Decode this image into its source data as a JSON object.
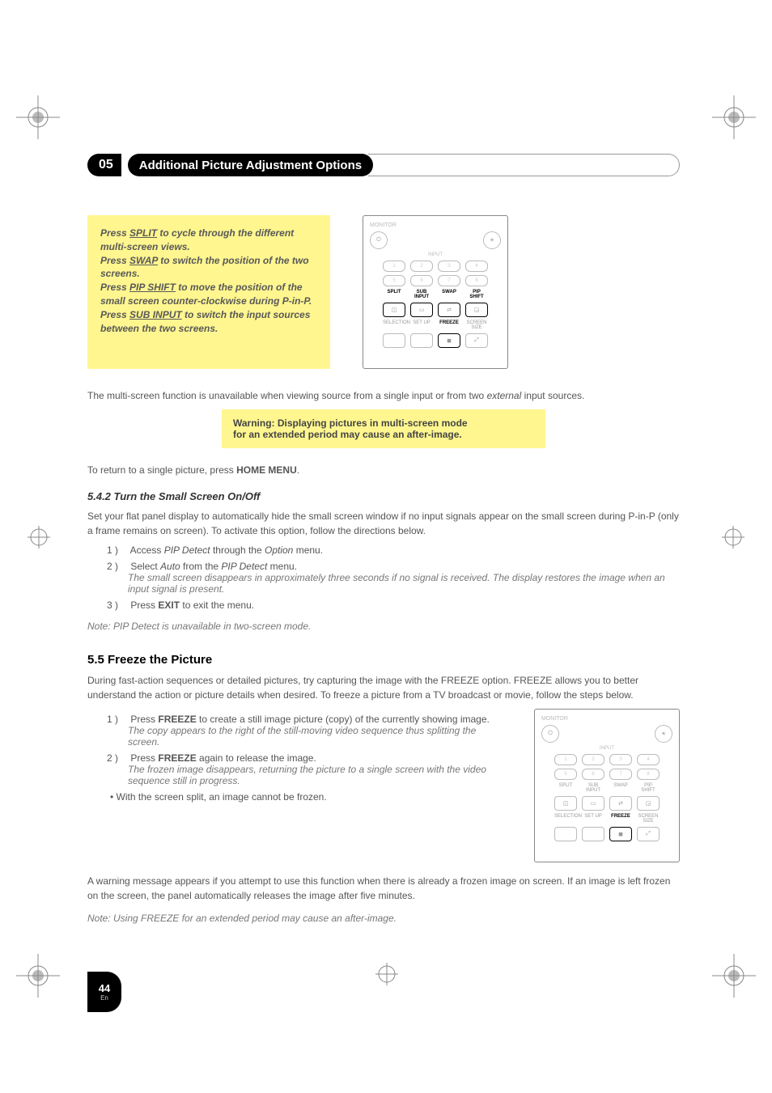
{
  "header": {
    "chapter_badge": "05",
    "chapter_title": "Additional Picture Adjustment Options"
  },
  "yellow_box": {
    "l1a": "Press ",
    "l1u": "SPLIT",
    "l1b": " to cycle through the different multi-screen views.",
    "l2a": "Press ",
    "l2u": "SWAP",
    "l2b": " to switch the position of the two screens.",
    "l3a": "Press ",
    "l3u": "PIP SHIFT",
    "l3b": " to move the position of the small screen counter-clockwise during P-in-P.",
    "l4a": "Press ",
    "l4u": "SUB INPUT",
    "l4b": " to switch the input sources between the two screens."
  },
  "remote": {
    "title": "MONITOR",
    "input_label": "INPUT",
    "row_nums_a": [
      "1",
      "2",
      "3",
      "4"
    ],
    "row_nums_b": [
      "5",
      "6",
      "7",
      "8"
    ],
    "labels_row1": {
      "split": "SPLIT",
      "sub": "SUB INPUT",
      "swap": "SWAP",
      "pip": "PIP SHIFT"
    },
    "labels_row2": {
      "sel": "SELECTION",
      "setup": "SET UP",
      "freeze": "FREEZE",
      "size": "SCREEN SIZE"
    }
  },
  "p_multi_unavail_a": "The multi-screen function is unavailable when viewing source from a single input or from two ",
  "p_multi_unavail_i": "external",
  "p_multi_unavail_b": " input sources.",
  "warning_l1": "Warning: Displaying pictures in multi-screen mode",
  "warning_l2": "for an extended period may cause an after-image.",
  "return_a": "To return to a single picture, press ",
  "return_b": "HOME MENU",
  "return_c": ".",
  "sec_542": "5.4.2    Turn the Small Screen On/Off",
  "sec542_intro": "Set your flat panel display to automatically hide the small screen window if no input signals appear on the small screen during P-in-P (only a frame remains on screen). To activate this option, follow the directions below.",
  "s542_1a": "1 )",
  "s542_1b": "Access ",
  "s542_1i1": "PIP Detect",
  "s542_1c": " through the ",
  "s542_1i2": "Option",
  "s542_1d": " menu.",
  "s542_2a": "2 )",
  "s542_2b": "Select ",
  "s542_2i1": "Auto",
  "s542_2c": " from the ",
  "s542_2i2": "PIP Detect",
  "s542_2d": " menu.",
  "s542_2sub": "The small screen disappears in approximately three seconds if no signal is received. The display restores the image when an input signal is present.",
  "s542_3a": "3 )",
  "s542_3b": "Press ",
  "s542_3bold": "EXIT",
  "s542_3c": " to exit the menu.",
  "note_542": "Note: PIP Detect is unavailable in two-screen mode.",
  "sec_55": "5.5   Freeze the Picture",
  "sec55_intro": "During fast-action sequences or detailed pictures, try capturing the image with the FREEZE option. FREEZE allows you to better understand the action or picture details when desired. To freeze a picture from a TV broadcast or movie, follow the steps below.",
  "s55_1a": "1 )",
  "s55_1b": "Press ",
  "s55_1bold": "FREEZE",
  "s55_1c": " to create a still image picture (copy) of the currently showing image.",
  "s55_1sub": "The copy appears to the right of the still-moving video sequence thus splitting the screen.",
  "s55_2a": "2 )",
  "s55_2b": "Press ",
  "s55_2bold": "FREEZE",
  "s55_2c": " again to release the image.",
  "s55_2sub": "The frozen image disappears, returning the picture to a single screen with the video sequence still in progress.",
  "s55_bullet": "• With the screen split, an image cannot be frozen.",
  "p_warn_frozen": "A warning message appears if you attempt to use this function when there is already a frozen image on screen. If an image is left frozen on the screen, the panel automatically releases the image after five minutes.",
  "note_55": "Note: Using FREEZE for an extended period may cause an after-image.",
  "footer": {
    "page": "44",
    "lang": "En"
  }
}
